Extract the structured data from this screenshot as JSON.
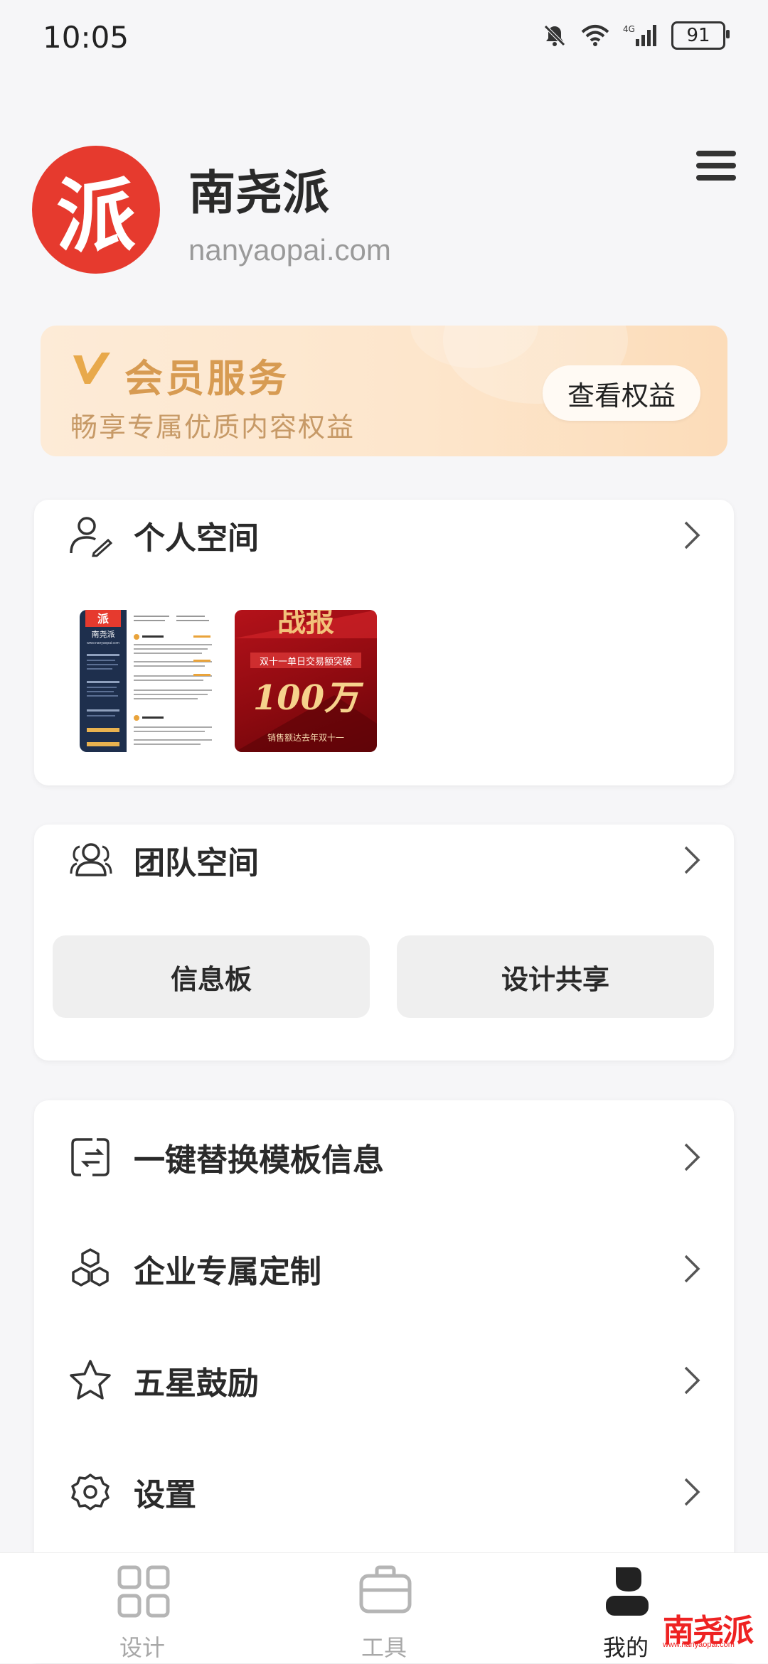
{
  "status_bar": {
    "time": "10:05",
    "battery": "91",
    "network": "4G"
  },
  "profile": {
    "logo_char": "派",
    "name": "南尧派",
    "website": "nanyaopai.com"
  },
  "vip": {
    "mark": "V",
    "title": "会员服务",
    "subtitle": "畅享专属优质内容权益",
    "button": "查看权益"
  },
  "personal_space": {
    "title": "个人空间",
    "resume_thumb": {
      "name": "南尧派",
      "url": "www.nanyaopai.com"
    },
    "poster_thumb": {
      "headline": "战报",
      "line1": "双十一单日交易额突破",
      "big": "100万",
      "line2": "销售额达去年双十一"
    }
  },
  "team_space": {
    "title": "团队空间",
    "buttons": [
      "信息板",
      "设计共享"
    ]
  },
  "menu_items": [
    {
      "label": "一键替换模板信息",
      "icon": "replace-template-icon"
    },
    {
      "label": "企业专属定制",
      "icon": "enterprise-custom-icon"
    },
    {
      "label": "五星鼓励",
      "icon": "star-icon"
    },
    {
      "label": "设置",
      "icon": "settings-gear-icon"
    }
  ],
  "bottom_nav": [
    {
      "label": "设计",
      "icon": "design-grid-icon",
      "active": false
    },
    {
      "label": "工具",
      "icon": "toolbox-icon",
      "active": false
    },
    {
      "label": "我的",
      "icon": "profile-person-icon",
      "active": true
    }
  ],
  "watermark": {
    "text": "南尧派",
    "url": "www.nanyaopai.com"
  },
  "colors": {
    "brand_red": "#e63a2e",
    "vip_gold": "#d79b52",
    "background": "#f6f6f8"
  }
}
